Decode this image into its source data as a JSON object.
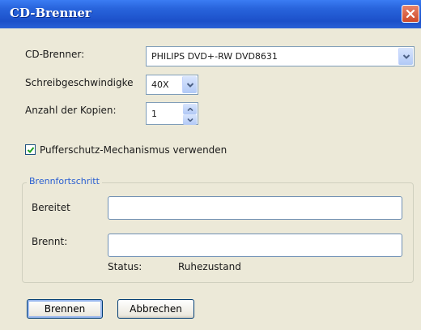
{
  "window": {
    "title": "CD-Brenner"
  },
  "form": {
    "burner_label": "CD-Brenner:",
    "burner_value": "PHILIPS DVD+-RW DVD8631",
    "speed_label": "Schreibgeschwindigke",
    "speed_value": "40X",
    "copies_label": "Anzahl der Kopien:",
    "copies_value": "1",
    "buffer_label": "Pufferschutz-Mechanismus verwenden",
    "buffer_checked": true
  },
  "progress": {
    "group_title": "Brennfortschritt",
    "prepared_label": "Bereitet",
    "prepared_percent": 0,
    "burning_label": "Brennt:",
    "burning_percent": 0,
    "status_label": "Status:",
    "status_value": "Ruhezustand"
  },
  "buttons": {
    "burn": "Brennen",
    "cancel": "Abbrechen"
  },
  "colors": {
    "title_bar": "#2864dc",
    "dialog_bg": "#ece9d8",
    "group_title": "#2a5fd1"
  }
}
